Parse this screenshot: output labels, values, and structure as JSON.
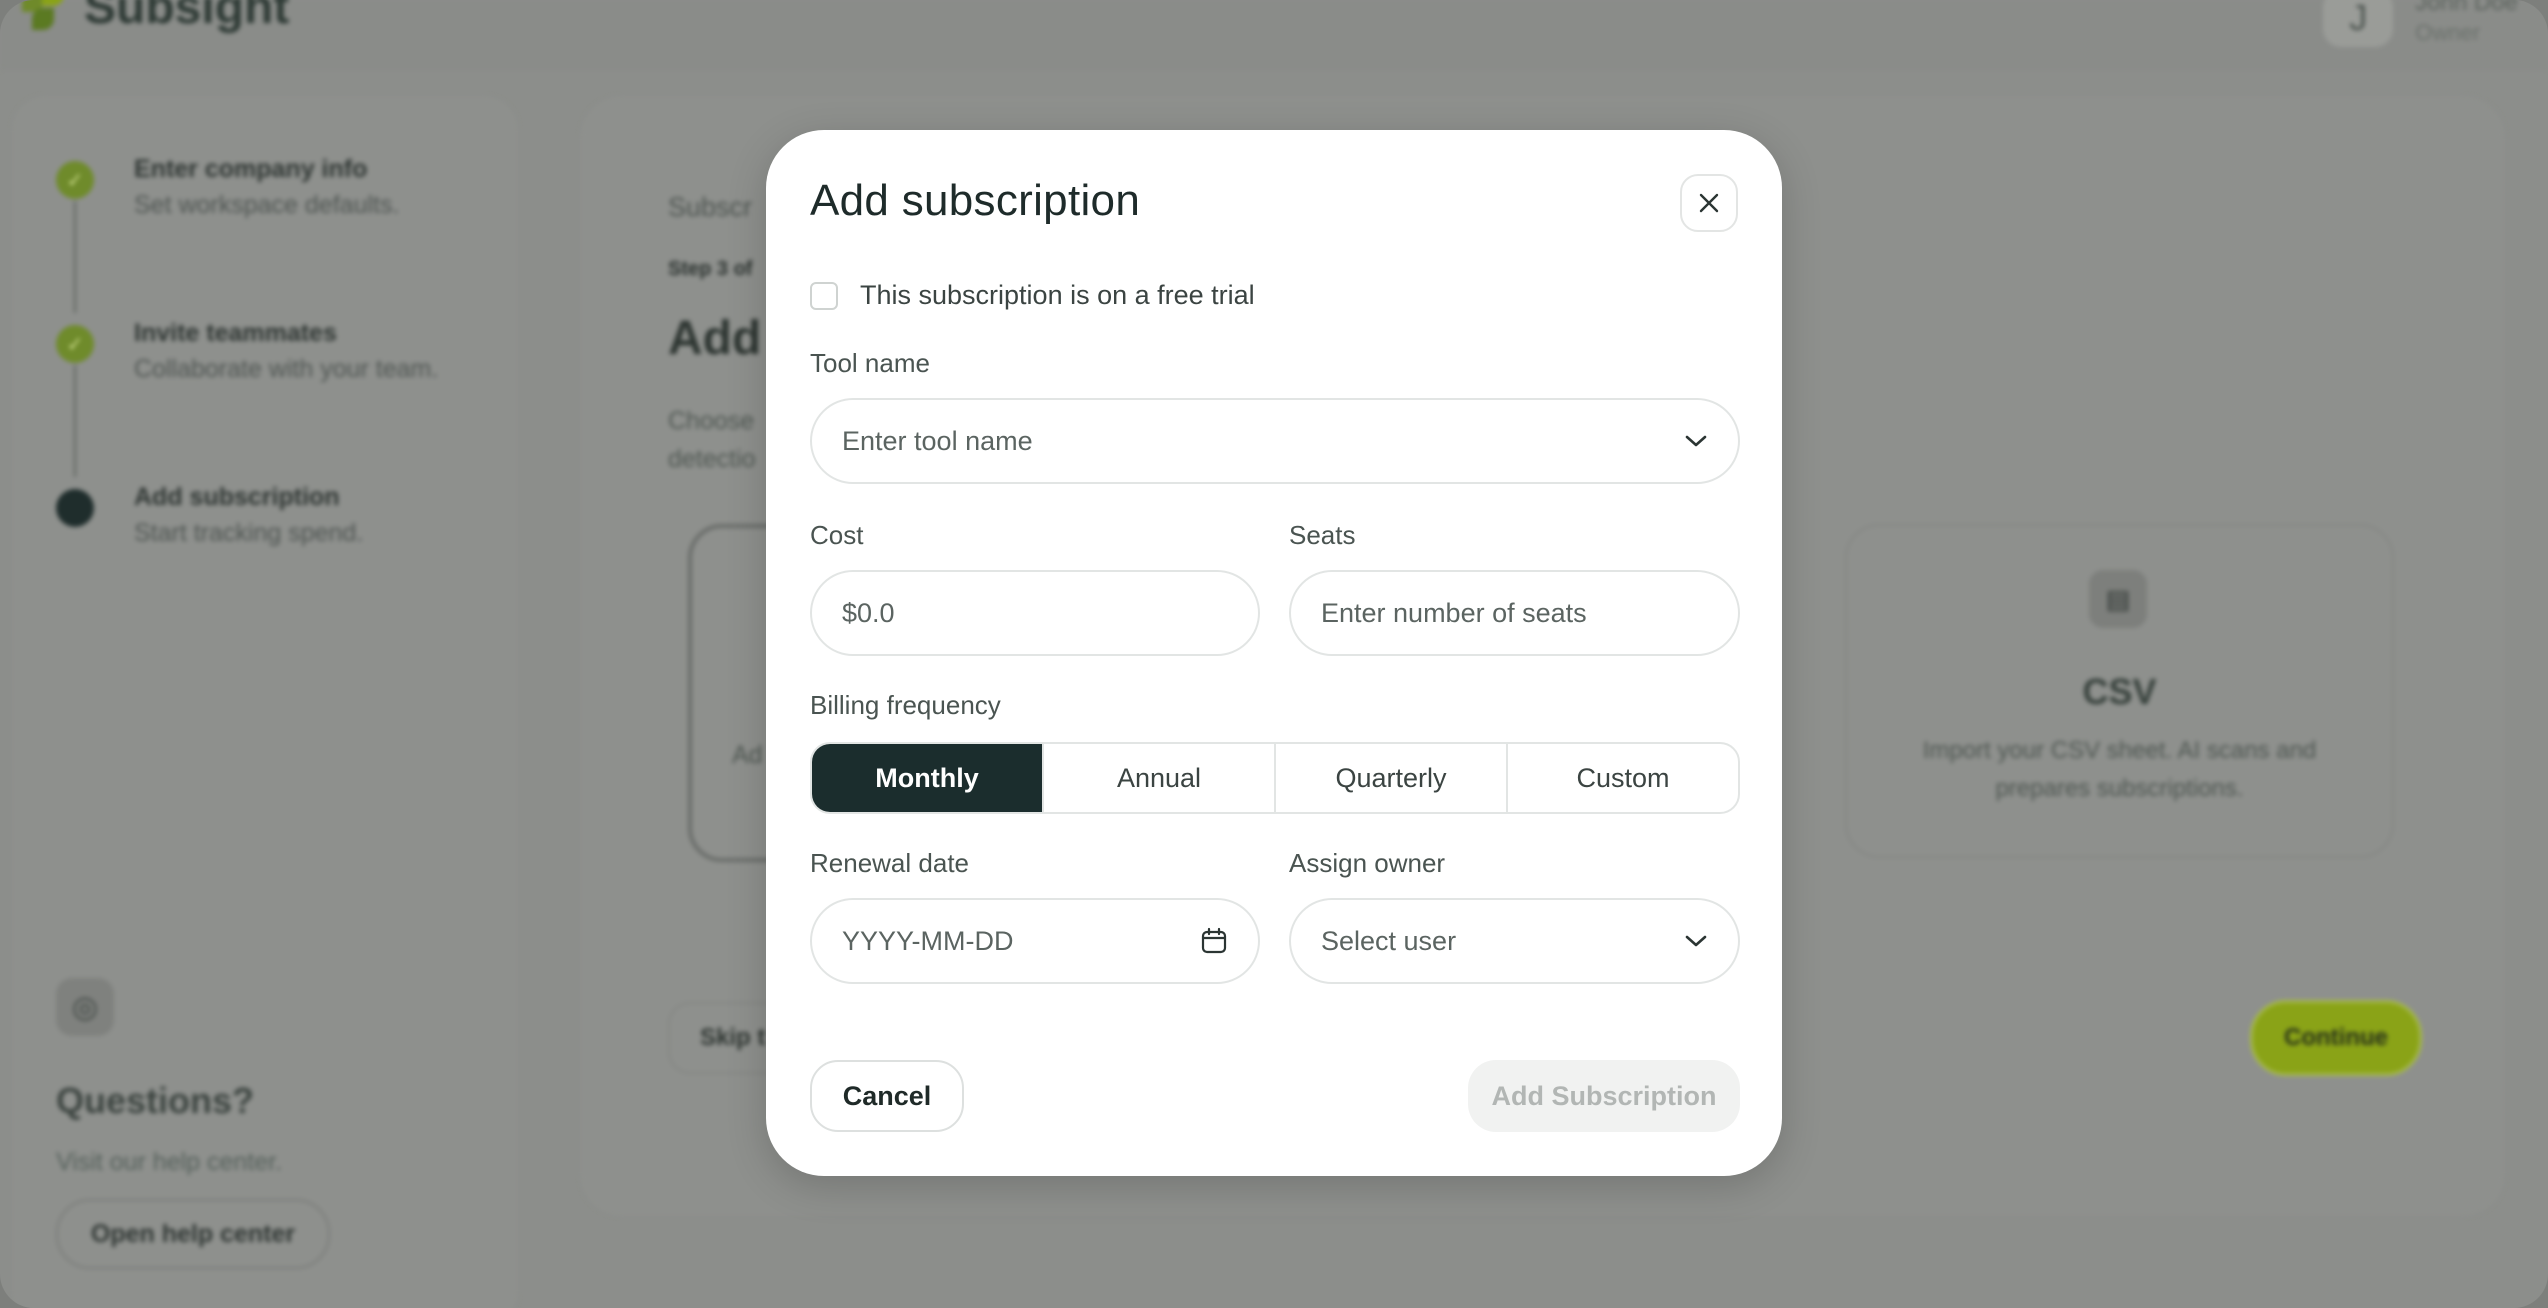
{
  "app": {
    "brand": "Subsight",
    "user_initial": "J",
    "user_name": "John Doe",
    "user_role": "Owner"
  },
  "sidebar": {
    "steps": [
      {
        "title": "Enter company info",
        "subtitle": "Set workspace defaults.",
        "status": "done"
      },
      {
        "title": "Invite teammates",
        "subtitle": "Collaborate with your team.",
        "status": "done"
      },
      {
        "title": "Add subscription",
        "subtitle": "Start tracking spend.",
        "status": "current"
      }
    ],
    "help": {
      "title": "Questions?",
      "subtitle": "Visit our help center.",
      "button": "Open help center"
    }
  },
  "main": {
    "breadcrumb": "Subscr",
    "step_label": "Step 3 of",
    "title": "Add a",
    "description_line1": "Choose",
    "description_line2": "detectio",
    "card_partial_label": "Ad",
    "csv_card": {
      "icon": "csv-file-icon",
      "title": "CSV",
      "description": "Import your CSV sheet. AI scans and prepares subscriptions."
    },
    "skip_label": "Skip t",
    "continue_label": "Continue"
  },
  "modal": {
    "title": "Add subscription",
    "free_trial_label": "This subscription is on a free trial",
    "tool_name": {
      "label": "Tool name",
      "placeholder": "Enter tool name"
    },
    "cost": {
      "label": "Cost",
      "placeholder": "$0.0"
    },
    "seats": {
      "label": "Seats",
      "placeholder": "Enter number of seats"
    },
    "billing_frequency": {
      "label": "Billing frequency",
      "options": [
        "Monthly",
        "Annual",
        "Quarterly",
        "Custom"
      ],
      "selected": "Monthly"
    },
    "renewal_date": {
      "label": "Renewal date",
      "placeholder": "YYYY-MM-DD"
    },
    "assign_owner": {
      "label": "Assign owner",
      "placeholder": "Select user"
    },
    "cancel_label": "Cancel",
    "submit_label": "Add Subscription"
  },
  "colors": {
    "accent_dark": "#1b2d2d",
    "brand_green": "#8aa317",
    "overlay": "#8e908d"
  }
}
